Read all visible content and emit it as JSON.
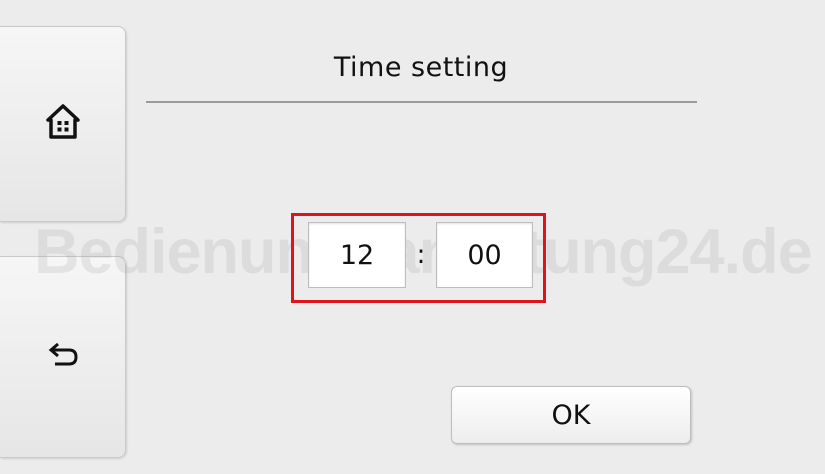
{
  "header": {
    "title": "Time setting"
  },
  "sidebar": {
    "home_icon": "home-icon",
    "back_icon": "back-arrow-icon"
  },
  "time": {
    "hour": "12",
    "separator": ":",
    "minute": "00"
  },
  "footer": {
    "ok_label": "OK"
  },
  "watermark": {
    "text": "Bedienungsanleitung24.de"
  },
  "colors": {
    "background": "#ececec",
    "highlight": "#e0121b"
  }
}
